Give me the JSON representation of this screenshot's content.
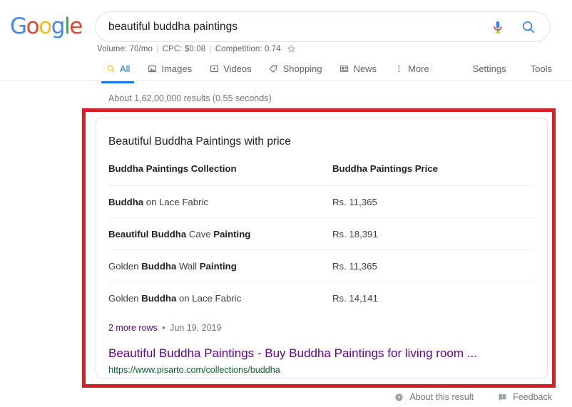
{
  "header": {
    "logo": {
      "letters": [
        {
          "char": "G",
          "color": "#4285f4"
        },
        {
          "char": "o",
          "color": "#ea4335"
        },
        {
          "char": "o",
          "color": "#fbbc05"
        },
        {
          "char": "g",
          "color": "#4285f4"
        },
        {
          "char": "l",
          "color": "#34a853"
        },
        {
          "char": "e",
          "color": "#ea4335"
        }
      ],
      "alt": "Google"
    },
    "search": {
      "value": "beautiful buddha paintings",
      "placeholder": "Search",
      "mic_icon": "microphone-icon",
      "search_icon": "search-icon"
    },
    "keyword_metrics": {
      "volume_label": "Volume:",
      "volume_value": "70/mo",
      "cpc_label": "CPC:",
      "cpc_value": "$0.08",
      "competition_label": "Competition:",
      "competition_value": "0.74",
      "star_icon": "star-icon",
      "full_text": "Volume: 70/mo | CPC: $0.08 | Competition: 0.74"
    },
    "tabs": [
      {
        "label": "All",
        "icon": "search-icon",
        "active": true
      },
      {
        "label": "Images",
        "icon": "image-icon",
        "active": false
      },
      {
        "label": "Videos",
        "icon": "video-icon",
        "active": false
      },
      {
        "label": "Shopping",
        "icon": "tag-icon",
        "active": false
      },
      {
        "label": "News",
        "icon": "news-icon",
        "active": false
      },
      {
        "label": "More",
        "icon": "more-vertical-icon",
        "active": false
      }
    ],
    "tools": [
      {
        "label": "Settings"
      },
      {
        "label": "Tools"
      }
    ]
  },
  "result_stats": "About 1,62,00,000 results (0.55 seconds)",
  "featured_snippet": {
    "title": "Beautiful Buddha Paintings with price",
    "table": {
      "headers": [
        "Buddha Paintings Collection",
        "Buddha Paintings Price"
      ],
      "rows": [
        {
          "name_parts": [
            {
              "text": "Buddha",
              "bold": true
            },
            {
              "text": " on Lace Fabric",
              "bold": false
            }
          ],
          "price": "Rs. 11,365"
        },
        {
          "name_parts": [
            {
              "text": "Beautiful Buddha",
              "bold": true
            },
            {
              "text": " Cave ",
              "bold": false
            },
            {
              "text": "Painting",
              "bold": true
            }
          ],
          "price": "Rs. 18,391"
        },
        {
          "name_parts": [
            {
              "text": "Golden ",
              "bold": false
            },
            {
              "text": "Buddha",
              "bold": true
            },
            {
              "text": " Wall ",
              "bold": false
            },
            {
              "text": "Painting",
              "bold": true
            }
          ],
          "price": "Rs. 11,365"
        },
        {
          "name_parts": [
            {
              "text": "Golden ",
              "bold": false
            },
            {
              "text": "Buddha",
              "bold": true
            },
            {
              "text": " on Lace Fabric",
              "bold": false
            }
          ],
          "price": "Rs. 14,141"
        }
      ]
    },
    "more_rows_label": "2 more rows",
    "separator": "•",
    "date": "Jun 19, 2019",
    "link_title": "Beautiful Buddha Paintings - Buy Buddha Paintings for living room ...",
    "link_url": "https://www.pisarto.com/collections/buddha"
  },
  "footer": {
    "items": [
      {
        "label": "About this result",
        "icon": "help-circle-icon"
      },
      {
        "label": "Feedback",
        "icon": "feedback-icon"
      }
    ]
  },
  "annotation": {
    "color": "#d42027",
    "shape": "rectangle-highlight"
  }
}
